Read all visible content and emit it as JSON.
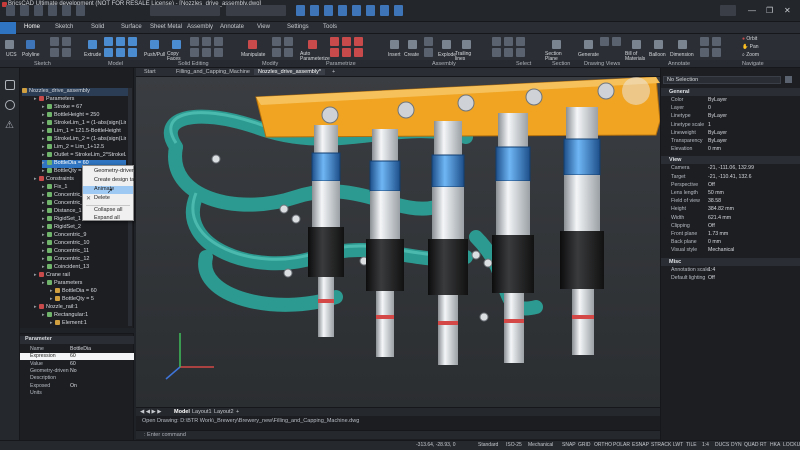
{
  "titlebar": {
    "title": "BricsCAD Ultimate development (NOT FOR RESALE License) - [Nozzles_drive_assembly.dwg]",
    "minimize": "—",
    "maximize": "❐",
    "close": "✕"
  },
  "tabs": [
    "Home",
    "Sketch",
    "Solid",
    "Surface",
    "Sheet Metal",
    "Assembly",
    "Annotate",
    "View",
    "Settings",
    "Tools"
  ],
  "ribbon_tools": [
    "UCS",
    "Polyline",
    "Extrude",
    "Push/Pull",
    "Copy Faces",
    "Manipulate",
    "Auto Parameterize",
    "Insert",
    "Create",
    "Explode",
    "Trailing lines",
    "Section Plane",
    "Generate",
    "Bill of Materials",
    "Balloon",
    "Dimension",
    "Orbit",
    "Pan",
    "Zoom"
  ],
  "ribbon_groups": [
    "Sketch",
    "Model",
    "Solid Editing",
    "Modify",
    "Parametrize",
    "Assembly",
    "Select",
    "Section",
    "Drawing Views",
    "Annotate",
    "Navigate"
  ],
  "tree": {
    "root": "Nozzles_drive_assembly",
    "items": [
      {
        "label": "Parameters",
        "indent": 1
      },
      {
        "label": "Stroke = 67",
        "indent": 2
      },
      {
        "label": "BottleHeight = 250",
        "indent": 2
      },
      {
        "label": "StrokeLim_1 = (1-abs(sign(Lim_1-...",
        "indent": 2
      },
      {
        "label": "Lim_1 = 121.5-BottleHeight",
        "indent": 2
      },
      {
        "label": "StrokeLim_2 = (1-abs(sign(Lim_2-...",
        "indent": 2
      },
      {
        "label": "Lim_2 = Lim_1+12.5",
        "indent": 2
      },
      {
        "label": "Outlet = StrokeLim_2*StrokeLim_1...",
        "indent": 2
      },
      {
        "label": "BottleDia = 60",
        "indent": 2,
        "selected": true
      },
      {
        "label": "BottleQty = 5",
        "indent": 2
      },
      {
        "label": "Constraints",
        "indent": 1
      },
      {
        "label": "Fix_1",
        "indent": 2
      },
      {
        "label": "Concentric_2",
        "indent": 2
      },
      {
        "label": "Concentric_3",
        "indent": 2
      },
      {
        "label": "Distance_1",
        "indent": 2
      },
      {
        "label": "RigidSet_1",
        "indent": 2
      },
      {
        "label": "RigidSet_2",
        "indent": 2
      },
      {
        "label": "Concentric_9",
        "indent": 2
      },
      {
        "label": "Concentric_10",
        "indent": 2
      },
      {
        "label": "Concentric_11",
        "indent": 2
      },
      {
        "label": "Concentric_12",
        "indent": 2
      },
      {
        "label": "Coincident_13",
        "indent": 2
      },
      {
        "label": "Crane rail",
        "indent": 1
      },
      {
        "label": "Parameters",
        "indent": 2
      },
      {
        "label": "BottleDia = 60",
        "indent": 3
      },
      {
        "label": "BottleQty = 5",
        "indent": 3
      },
      {
        "label": "Nozzle_rail:1",
        "indent": 1
      },
      {
        "label": "Rectangular:1",
        "indent": 2
      },
      {
        "label": "Element:1",
        "indent": 3
      }
    ]
  },
  "context_menu": {
    "items": [
      "Geometry-driven",
      "Create design table",
      "Animate",
      "Delete",
      "Collapse all",
      "Expand all"
    ],
    "highlighted": "Animate"
  },
  "param_panel": {
    "header": "Parameter",
    "rows": [
      {
        "k": "Name",
        "v": "BottleDia"
      },
      {
        "k": "Expression",
        "v": "60"
      },
      {
        "k": "Value",
        "v": "60"
      },
      {
        "k": "Geometry-driven",
        "v": "No"
      },
      {
        "k": "Description",
        "v": ""
      },
      {
        "k": "Exposed",
        "v": "On"
      },
      {
        "k": "Units",
        "v": ""
      }
    ]
  },
  "doc_tabs": [
    "Start",
    "Filling_and_Capping_Machine",
    "Nozzles_drive_assembly*",
    "+"
  ],
  "layout_tabs": [
    "Model",
    "Layout1",
    "Layout2",
    "+"
  ],
  "command": {
    "history": "Open Drawing: D:\\BTR Work\\_Brewery\\Brewery_new\\Filling_and_Capping_Machine.dwg",
    "prompt": ": Enter command"
  },
  "properties": {
    "selection": "No Selection",
    "sections": [
      {
        "name": "General",
        "rows": [
          {
            "k": "Color",
            "v": "ByLayer"
          },
          {
            "k": "Layer",
            "v": "0"
          },
          {
            "k": "Linetype",
            "v": "ByLayer"
          },
          {
            "k": "Linetype scale",
            "v": "1"
          },
          {
            "k": "Lineweight",
            "v": "ByLayer"
          },
          {
            "k": "Transparency",
            "v": "ByLayer"
          },
          {
            "k": "Elevation",
            "v": "0 mm"
          }
        ]
      },
      {
        "name": "View",
        "rows": [
          {
            "k": "Camera",
            "v": "-21, -111.06, 132.99"
          },
          {
            "k": "Target",
            "v": "-21, -110.41, 132.6"
          },
          {
            "k": "Perspective",
            "v": "Off"
          },
          {
            "k": "Lens length",
            "v": "50 mm"
          },
          {
            "k": "Field of view",
            "v": "38.58"
          },
          {
            "k": "Height",
            "v": "384.82 mm"
          },
          {
            "k": "Width",
            "v": "621.4 mm"
          },
          {
            "k": "Clipping",
            "v": "Off"
          },
          {
            "k": "Front plane",
            "v": "1.73 mm"
          },
          {
            "k": "Back plane",
            "v": "0 mm"
          },
          {
            "k": "Visual style",
            "v": "Mechanical"
          }
        ]
      },
      {
        "name": "Misc",
        "rows": [
          {
            "k": "Annotation scale",
            "v": "1:4"
          },
          {
            "k": "Default lighting",
            "v": "Off"
          }
        ]
      }
    ]
  },
  "status": {
    "coords": "-313.64, -28.93, 0",
    "items": [
      "Standard",
      "ISO-25",
      "Mechanical",
      "SNAP",
      "GRID",
      "ORTHO",
      "POLAR",
      "ESNAP",
      "STRACK",
      "LWT",
      "TILE",
      "1:4",
      "DUCS",
      "DYN",
      "QUAD",
      "RT",
      "HKA",
      "LOCKUI",
      "None"
    ]
  },
  "colors": {
    "accent": "#2f74c0",
    "beam": "#f0a422",
    "spring": "#3f8fd6",
    "tube": "#2f9b92"
  }
}
